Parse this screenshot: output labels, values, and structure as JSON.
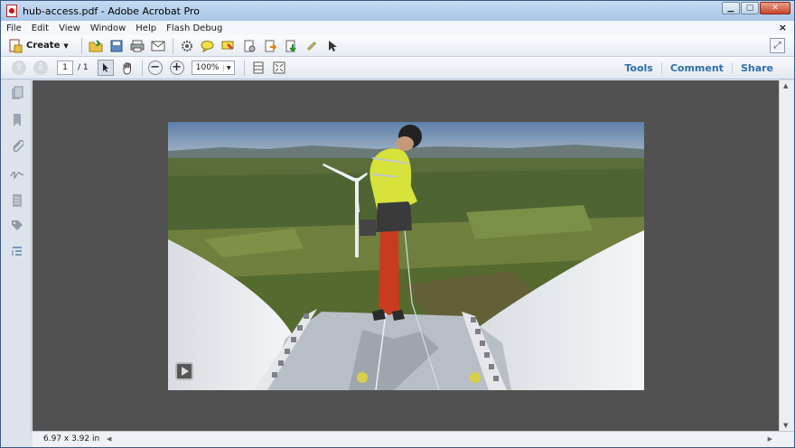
{
  "window": {
    "title": "hub-access.pdf - Adobe Acrobat Pro",
    "min_glyph": "▁",
    "max_glyph": "▢",
    "close_glyph": "✕"
  },
  "menu": {
    "items": [
      "File",
      "Edit",
      "View",
      "Window",
      "Help",
      "Flash Debug"
    ],
    "doc_close_glyph": "×"
  },
  "toolbar": {
    "create_label": "Create",
    "create_caret": "▼",
    "expand_glyph": "⤢"
  },
  "nav": {
    "prev_glyph": "⇧",
    "next_glyph": "⇩",
    "page_value": "1",
    "page_total": "/ 1",
    "zoom_out_glyph": "−",
    "zoom_in_glyph": "+",
    "zoom_value": "100%",
    "zoom_caret": "▼"
  },
  "panels": {
    "tools": "Tools",
    "comment": "Comment",
    "share": "Share"
  },
  "status": {
    "page_size": "6.97 x 3.92 in",
    "scroll_left": "◀",
    "scroll_right": "▶",
    "scroll_up": "▲",
    "scroll_down": "▼"
  }
}
